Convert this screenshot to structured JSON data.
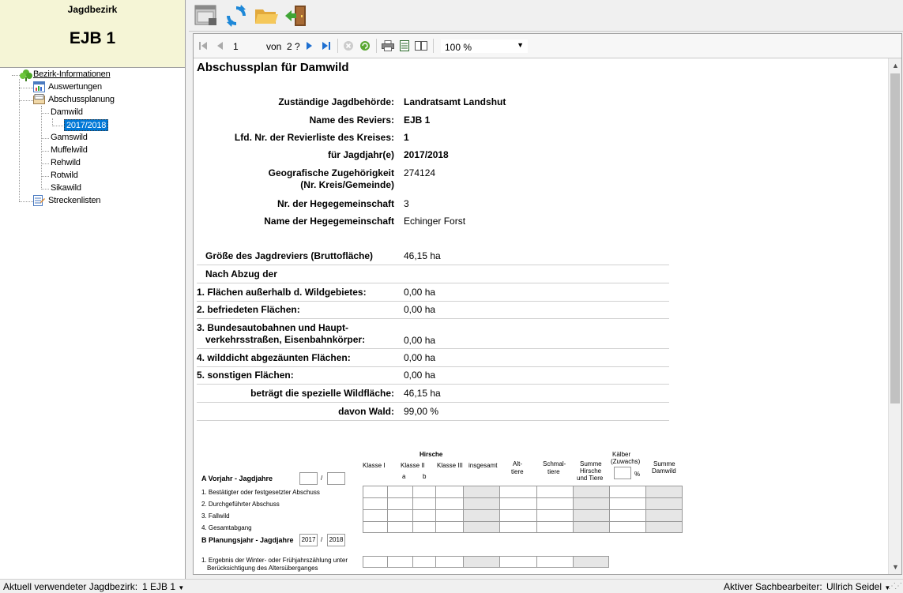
{
  "left_panel": {
    "header_label": "Jagdbezirk",
    "district": "EJB 1",
    "tree": {
      "bezirk": "Bezirk-Informationen",
      "auswertungen": "Auswertungen",
      "abschussplanung": "Abschussplanung",
      "damwild": "Damwild",
      "year": "2017/2018",
      "gamswild": "Gamswild",
      "muffelwild": "Muffelwild",
      "rehwild": "Rehwild",
      "rotwild": "Rotwild",
      "sikawild": "Sikawild",
      "streckenlisten": "Streckenlisten"
    }
  },
  "viewer_toolbar": {
    "page": "1",
    "of_label": "von",
    "total_pages": "2 ?",
    "zoom": "100 %"
  },
  "report": {
    "title": "Abschussplan für Damwild",
    "info": [
      {
        "label": "Zuständige Jagdbehörde:",
        "value": "Landratsamt Landshut"
      },
      {
        "label": "Name des Reviers:",
        "value": "EJB 1"
      },
      {
        "label": "Lfd. Nr. der Revierliste des Kreises:",
        "value": "1"
      },
      {
        "label": "für Jagdjahr(e)",
        "value": "2017/2018"
      },
      {
        "label_line1": "Geografische Zugehörigkeit",
        "label_line2": "(Nr. Kreis/Gemeinde)",
        "value": "274124"
      },
      {
        "label": "Nr. der Hegegemeinschaft",
        "value": "3"
      },
      {
        "label": "Name der Hegegemeinschaft",
        "value": "Echinger Forst"
      }
    ],
    "area": {
      "gross_label": "Größe des Jagdreviers (Bruttofläche)",
      "gross_value": "46,15 ha",
      "after_label": "Nach Abzug der",
      "item1_label": "1. Flächen außerhalb d. Wildgebietes:",
      "item1_value": "0,00 ha",
      "item2_label": "2. befriedeten Flächen:",
      "item2_value": "0,00 ha",
      "item3_line1": "3. Bundesautobahnen und Haupt-",
      "item3_line2": "verkehrsstraßen, Eisenbahnkörper:",
      "item3_value": "0,00 ha",
      "item4_label": "4. wilddicht abgezäunten Flächen:",
      "item4_value": "0,00 ha",
      "item5_label": "5. sonstigen Flächen:",
      "item5_value": "0,00 ha",
      "special_label": "beträgt die spezielle Wildfläche:",
      "special_value": "46,15 ha",
      "forest_label": "davon Wald:",
      "forest_value": "99,00 %"
    },
    "table": {
      "hirsche": "Hirsche",
      "klasse1": "Klasse I",
      "klasse2": "Klasse II",
      "a": "a",
      "b": "b",
      "klasse3": "Klasse III",
      "insgesamt": "insgesamt",
      "alttiere_1": "Alt-",
      "alttiere_2": "tiere",
      "schmal_1": "Schmal-",
      "schmal_2": "tiere",
      "summe_ht_1": "Summe",
      "summe_ht_2": "Hirsche",
      "summe_ht_3": "und Tiere",
      "kaelber_1": "Kälber",
      "kaelber_2": "(Zuwachs)",
      "percent": "%",
      "summe_dw_1": "Summe",
      "summe_dw_2": "Damwild",
      "a_title": "A Vorjahr - Jagdjahre",
      "slash": "/",
      "row1": "1. Bestätigter oder festgesetzter Abschuss",
      "row2": "2. Durchgeführter Abschuss",
      "row3": "3. Fallwild",
      "row4": "4. Gesamtabgang",
      "b_title": "B Planungsjahr - Jagdjahre",
      "b_from": "2017",
      "b_to": "2018",
      "b_row1_line1": "1. Ergebnis der Winter- oder Frühjahrszählung unter",
      "b_row1_line2": "Berücksichtigung des Altersüberganges"
    }
  },
  "status_bar": {
    "left_label": "Aktuell verwendeter Jagdbezirk:",
    "left_value": "1 EJB 1",
    "right_label": "Aktiver Sachbearbeiter:",
    "right_value": "Ullrich Seidel"
  },
  "colors": {
    "header_bg": "#f5f5d6",
    "selection": "#0078d7",
    "grey_cell": "#e6e6e6"
  }
}
